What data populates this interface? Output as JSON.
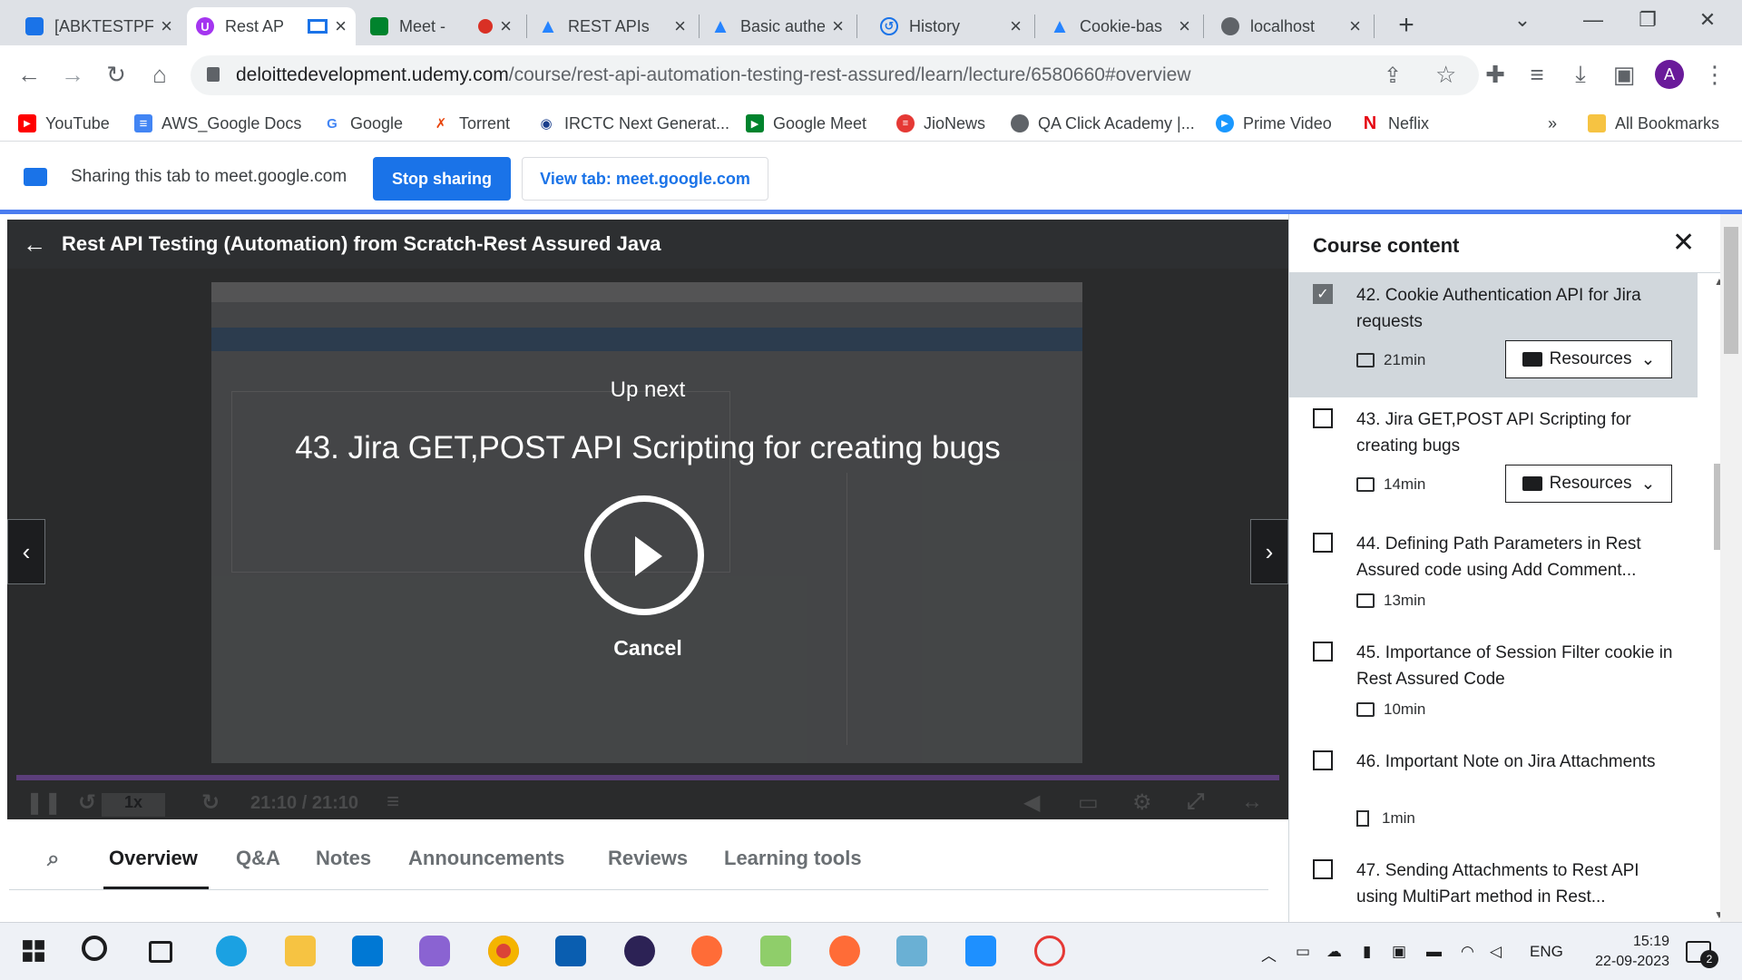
{
  "browser": {
    "tabs": [
      {
        "title": "[ABKTESTPF",
        "color": "#1a73e8"
      },
      {
        "title": "Rest AP",
        "color": "#a435f0"
      },
      {
        "title": "Meet -",
        "color": "#00832d"
      },
      {
        "title": "REST APIs",
        "color": "#2684ff"
      },
      {
        "title": "Basic authe",
        "color": "#2684ff"
      },
      {
        "title": "History",
        "color": "#1a73e8"
      },
      {
        "title": "Cookie-bas",
        "color": "#2684ff"
      },
      {
        "title": "localhost",
        "color": "#5f6368"
      }
    ],
    "url_host": "deloittedevelopment.udemy.com",
    "url_path": "/course/rest-api-automation-testing-rest-assured/learn/lecture/6580660#overview",
    "profile_initial": "A",
    "bookmarks": [
      {
        "label": "YouTube",
        "color": "#ff0000"
      },
      {
        "label": "AWS_Google Docs",
        "color": "#4285f4"
      },
      {
        "label": "Google",
        "color": "#4285f4"
      },
      {
        "label": "Torrent",
        "color": "#e8430a"
      },
      {
        "label": "IRCTC Next Generat...",
        "color": "#1a3e8c"
      },
      {
        "label": "Google Meet",
        "color": "#00832d"
      },
      {
        "label": "JioNews",
        "color": "#e53935"
      },
      {
        "label": "QA Click Academy |...",
        "color": "#5f6368"
      },
      {
        "label": "Prime Video",
        "color": "#1a98ff"
      },
      {
        "label": "Neflix",
        "color": "#e50914"
      }
    ],
    "all_bookmarks": "All Bookmarks",
    "overflow": "»"
  },
  "share": {
    "text": "Sharing this tab to meet.google.com",
    "stop": "Stop sharing",
    "view": "View tab: meet.google.com"
  },
  "player": {
    "course_title": "Rest API Testing (Automation) from Scratch-Rest Assured Java",
    "up_next": "Up next",
    "next_title": "43. Jira GET,POST API Scripting for creating bugs",
    "cancel": "Cancel",
    "speed": "1x",
    "time": "21:10 / 21:10",
    "progress": 1.0
  },
  "tabs": [
    "Overview",
    "Q&A",
    "Notes",
    "Announcements",
    "Reviews",
    "Learning tools"
  ],
  "sidebar": {
    "title": "Course content",
    "lectures": [
      {
        "title": "42. Cookie Authentication API for Jira requests",
        "duration": "21min",
        "checked": true,
        "resources": true,
        "current": true,
        "type": "video"
      },
      {
        "title": "43. Jira GET,POST API Scripting for creating bugs",
        "duration": "14min",
        "checked": false,
        "resources": true,
        "current": false,
        "type": "video"
      },
      {
        "title": "44. Defining Path Parameters in Rest Assured code using Add Comment...",
        "duration": "13min",
        "checked": false,
        "resources": false,
        "current": false,
        "type": "video"
      },
      {
        "title": "45. Importance of Session Filter cookie in Rest Assured Code",
        "duration": "10min",
        "checked": false,
        "resources": false,
        "current": false,
        "type": "video"
      },
      {
        "title": "46. Important Note on Jira Attachments",
        "duration": "1min",
        "checked": false,
        "resources": false,
        "current": false,
        "type": "article"
      },
      {
        "title": "47. Sending Attachments to Rest API using MultiPart method in Rest...",
        "duration": "",
        "checked": false,
        "resources": false,
        "current": false,
        "type": "video"
      }
    ],
    "resources_label": "Resources"
  },
  "taskbar": {
    "lang": "ENG",
    "time": "15:19",
    "date": "22-09-2023",
    "notifications": "2"
  }
}
